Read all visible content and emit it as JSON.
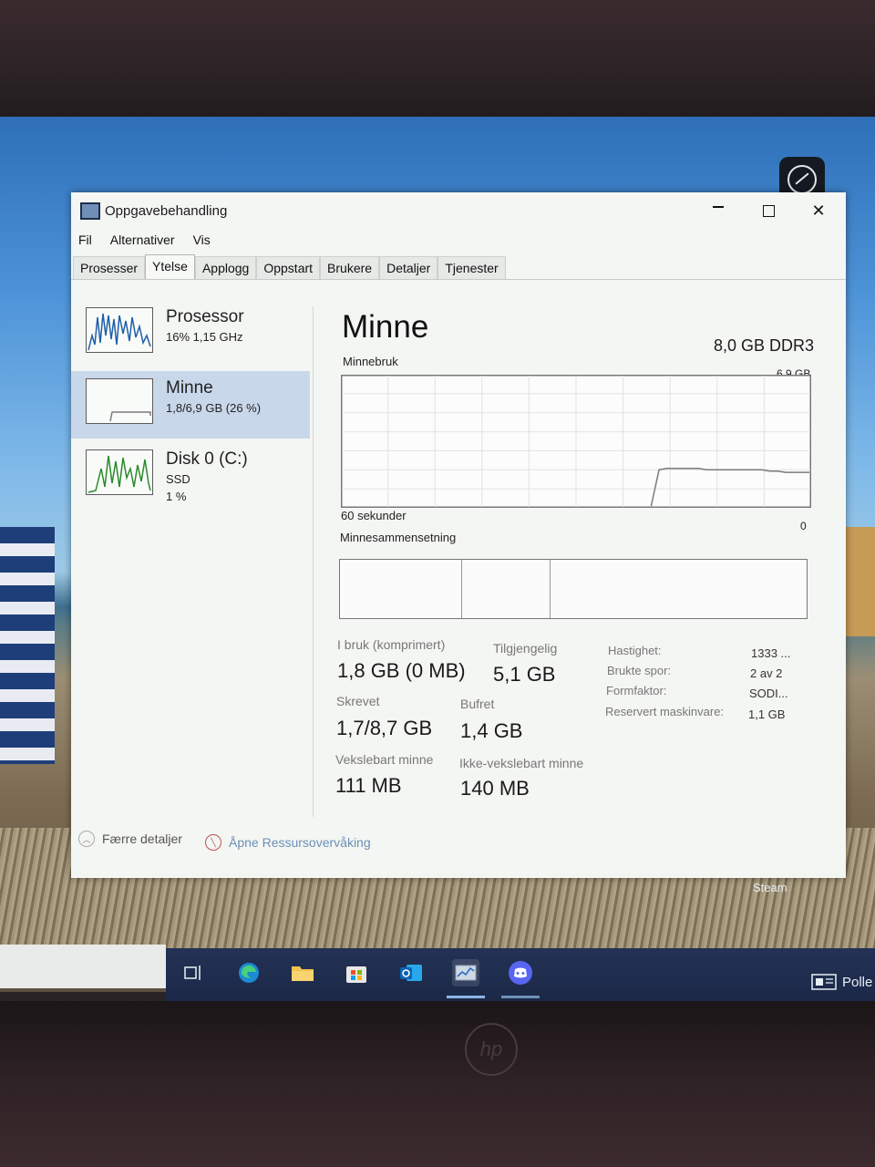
{
  "window": {
    "title": "Oppgavebehandling",
    "menu": [
      "Fil",
      "Alternativer",
      "Vis"
    ],
    "tabs": [
      "Prosesser",
      "Ytelse",
      "Applogg",
      "Oppstart",
      "Brukere",
      "Detaljer",
      "Tjenester"
    ],
    "active_tab": "Ytelse",
    "min_label": "—",
    "close_label": "✕"
  },
  "sidebar": {
    "items": [
      {
        "name": "Prosessor",
        "sub": "16%  1,15 GHz",
        "sub2": ""
      },
      {
        "name": "Minne",
        "sub": "1,8/6,9 GB (26 %)",
        "sub2": ""
      },
      {
        "name": "Disk 0 (C:)",
        "sub": "SSD",
        "sub2": "1 %"
      }
    ],
    "selected": "Minne"
  },
  "memory": {
    "title": "Minne",
    "spec": "8,0 GB DDR3",
    "usage_label": "Minnebruk",
    "usage_max": "6,9 GB",
    "time_label": "60 sekunder",
    "zero_label": "0",
    "composition_label": "Minnesammensetning",
    "composition_fractions": [
      0.26,
      0.19
    ],
    "usage_series": [
      0,
      0,
      0,
      0,
      0,
      0,
      0,
      0,
      0,
      0,
      0,
      0,
      0,
      0,
      0,
      0,
      0,
      0,
      0,
      0,
      0,
      0,
      0,
      0,
      0,
      0,
      0,
      0,
      0,
      0,
      0,
      0,
      0,
      0,
      0,
      0,
      0,
      0,
      0,
      0,
      0.28,
      0.29,
      0.29,
      0.29,
      0.29,
      0.29,
      0.28,
      0.28,
      0.28,
      0.28,
      0.28,
      0.28,
      0.28,
      0.28,
      0.27,
      0.27,
      0.26,
      0.26,
      0.26,
      0.26
    ]
  },
  "stats": {
    "in_use_label": "I bruk (komprimert)",
    "in_use_value": "1,8 GB (0 MB)",
    "available_label": "Tilgjengelig",
    "available_value": "5,1 GB",
    "committed_label": "Skrevet",
    "committed_value": "1,7/8,7 GB",
    "cached_label": "Bufret",
    "cached_value": "1,4 GB",
    "paged_label": "Vekslebart minne",
    "paged_value": "111 MB",
    "nonpaged_label": "Ikke-vekslebart minne",
    "nonpaged_value": "140 MB"
  },
  "details": [
    {
      "label": "Hastighet:",
      "value": "1333 ..."
    },
    {
      "label": "Brukte spor:",
      "value": "2 av 2"
    },
    {
      "label": "Formfaktor:",
      "value": "SODI..."
    },
    {
      "label": "Reservert maskinvare:",
      "value": "1,1 GB"
    }
  ],
  "footer": {
    "fewer_details": "Færre detaljer",
    "open_monitor": "Åpne Ressursovervåking"
  },
  "desktop": {
    "steam_label": "Steam",
    "taskbar_right": "Polle"
  },
  "colors": {
    "memory_line": "#7a7a7a",
    "cpu_line": "#1f5fa8",
    "disk_line": "#2b8a2b",
    "selected_bg": "#c9d7ea"
  }
}
